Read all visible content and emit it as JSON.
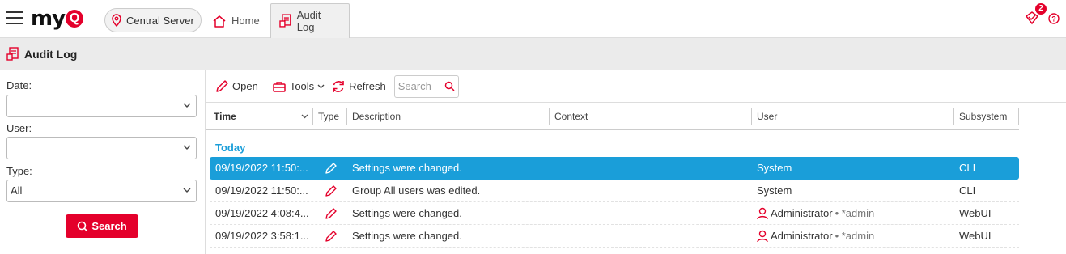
{
  "app": {
    "brand_my": "my",
    "brand_q": "Q",
    "server": "Central Server",
    "notifications_count": "2"
  },
  "tabs": [
    {
      "label": "Home",
      "icon": "home-icon"
    },
    {
      "label": "Audit Log",
      "icon": "audit-log-icon",
      "active": true
    }
  ],
  "page": {
    "title": "Audit Log"
  },
  "filters": {
    "date_label": "Date:",
    "date_value": "",
    "user_label": "User:",
    "user_value": "",
    "type_label": "Type:",
    "type_value": "All",
    "search_button": "Search"
  },
  "toolbar": {
    "open": "Open",
    "tools": "Tools",
    "refresh": "Refresh",
    "search_placeholder": "Search"
  },
  "columns": {
    "time": "Time",
    "type": "Type",
    "description": "Description",
    "context": "Context",
    "user": "User",
    "subsystem": "Subsystem"
  },
  "group": "Today",
  "rows": [
    {
      "time": "09/19/2022 11:50:...",
      "description": "Settings were changed.",
      "user": "System",
      "login": "",
      "subsystem": "CLI",
      "selected": true
    },
    {
      "time": "09/19/2022 11:50:...",
      "description": "Group All users was edited.",
      "user": "System",
      "login": "",
      "subsystem": "CLI"
    },
    {
      "time": "09/19/2022 4:08:4...",
      "description": "Settings were changed.",
      "user": "Administrator",
      "login": "• *admin",
      "subsystem": "WebUI"
    },
    {
      "time": "09/19/2022 3:58:1...",
      "description": "Settings were changed.",
      "user": "Administrator",
      "login": "• *admin",
      "subsystem": "WebUI"
    }
  ],
  "colors": {
    "brand": "#e4002b",
    "selection": "#1a9ed9"
  }
}
